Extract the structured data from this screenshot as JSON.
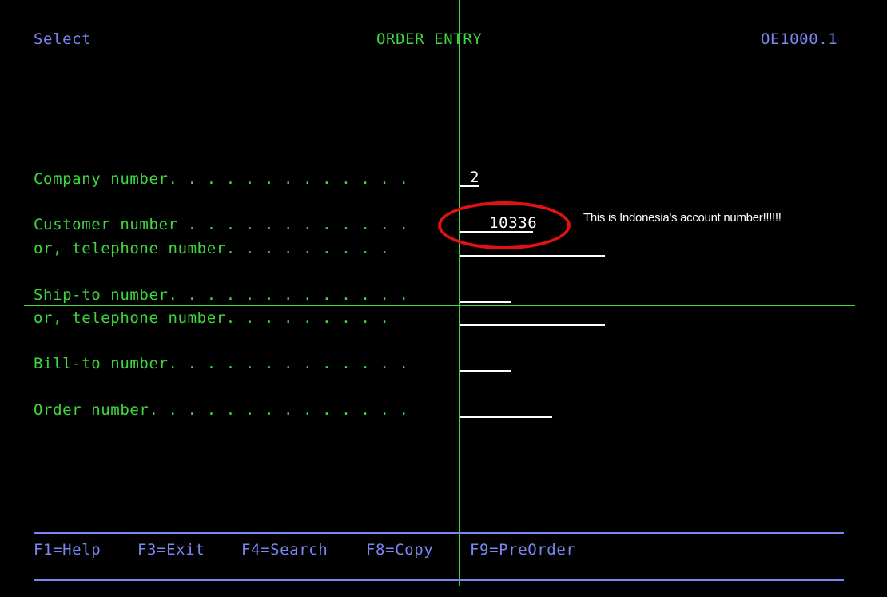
{
  "header": {
    "left": "Select",
    "title": "ORDER ENTRY",
    "screen_id": "OE1000.1"
  },
  "fields": {
    "company_label": "Company number. . . . . . . . . . . . .",
    "company_value": " 2",
    "customer_label": "Customer number . . . . . . . . . . . .",
    "customer_value": "   10336",
    "customer_phone_label": "or, telephone number. . . . . . . . .",
    "customer_phone_value": "",
    "shipto_label": "Ship-to number. . . . . . . . . . . . .",
    "shipto_value": "",
    "shipto_phone_label": "or, telephone number. . . . . . . . .",
    "shipto_phone_value": "",
    "billto_label": "Bill-to number. . . . . . . . . . . . .",
    "billto_value": "",
    "order_label": "Order number. . . . . . . . . . . . . .",
    "order_value": ""
  },
  "annotation": {
    "note": "This is Indonesia's account number!!!!!!",
    "circle_color": "#e51111"
  },
  "function_keys": {
    "f1": "F1=Help",
    "f3": "F3=Exit",
    "f4": "F4=Search",
    "f8": "F8=Copy",
    "f9": "F9=PreOrder"
  },
  "colors": {
    "background": "#000000",
    "label": "#3ed83e",
    "header": "#7b86f2",
    "input": "#ffffff",
    "annotation": "#e51111"
  }
}
